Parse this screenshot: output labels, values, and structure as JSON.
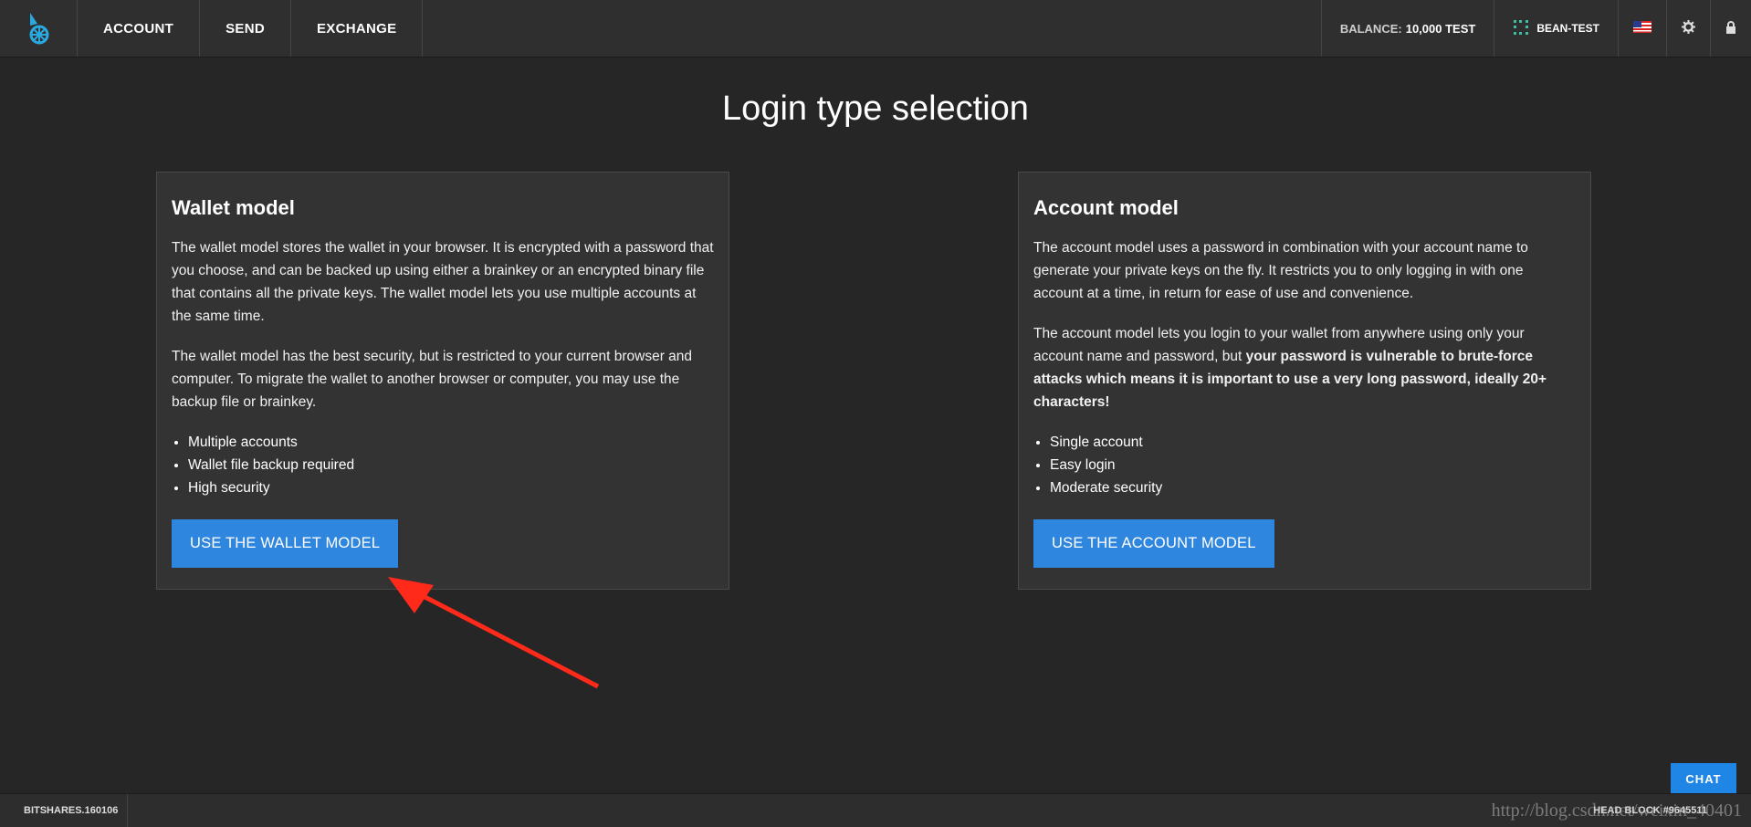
{
  "header": {
    "nav": [
      "ACCOUNT",
      "SEND",
      "EXCHANGE"
    ],
    "balance_label": "BALANCE:",
    "balance_value": "10,000 TEST",
    "account_name": "BEAN-TEST",
    "icons": [
      "bitshares-logo-icon",
      "identicon-icon",
      "us-flag-icon",
      "gear-icon",
      "lock-icon"
    ]
  },
  "main": {
    "title": "Login type selection",
    "wallet": {
      "heading": "Wallet model",
      "p1": "The wallet model stores the wallet in your browser. It is encrypted with a password that you choose, and can be backed up using either a brainkey or an encrypted binary file that contains all the private keys. The wallet model lets you use multiple accounts at the same time.",
      "p2": "The wallet model has the best security, but is restricted to your current browser and computer. To migrate the wallet to another browser or computer, you may use the backup file or brainkey.",
      "features": [
        "Multiple accounts",
        "Wallet file backup required",
        "High security"
      ],
      "button": "USE THE WALLET MODEL"
    },
    "account": {
      "heading": "Account model",
      "p1": "The account model uses a password in combination with your account name to generate your private keys on the fly. It restricts you to only logging in with one account at a time, in return for ease of use and convenience.",
      "p2_plain": "The account model lets you login to your wallet from anywhere using only your account name and password, but ",
      "p2_bold": "your password is vulnerable to brute-force attacks which means it is important to use a very long password, ideally 20+ characters!",
      "features": [
        "Single account",
        "Easy login",
        "Moderate security"
      ],
      "button": "USE THE ACCOUNT MODEL"
    }
  },
  "footer": {
    "version": "BITSHARES.160106",
    "head_block": "HEAD BLOCK #9645511",
    "chat": "CHAT",
    "watermark": "http://blog.csdn.net/weixin_40401"
  },
  "colors": {
    "background": "#262626",
    "card": "#333333",
    "button": "#2f86de",
    "arrow": "#ff2a1a"
  }
}
